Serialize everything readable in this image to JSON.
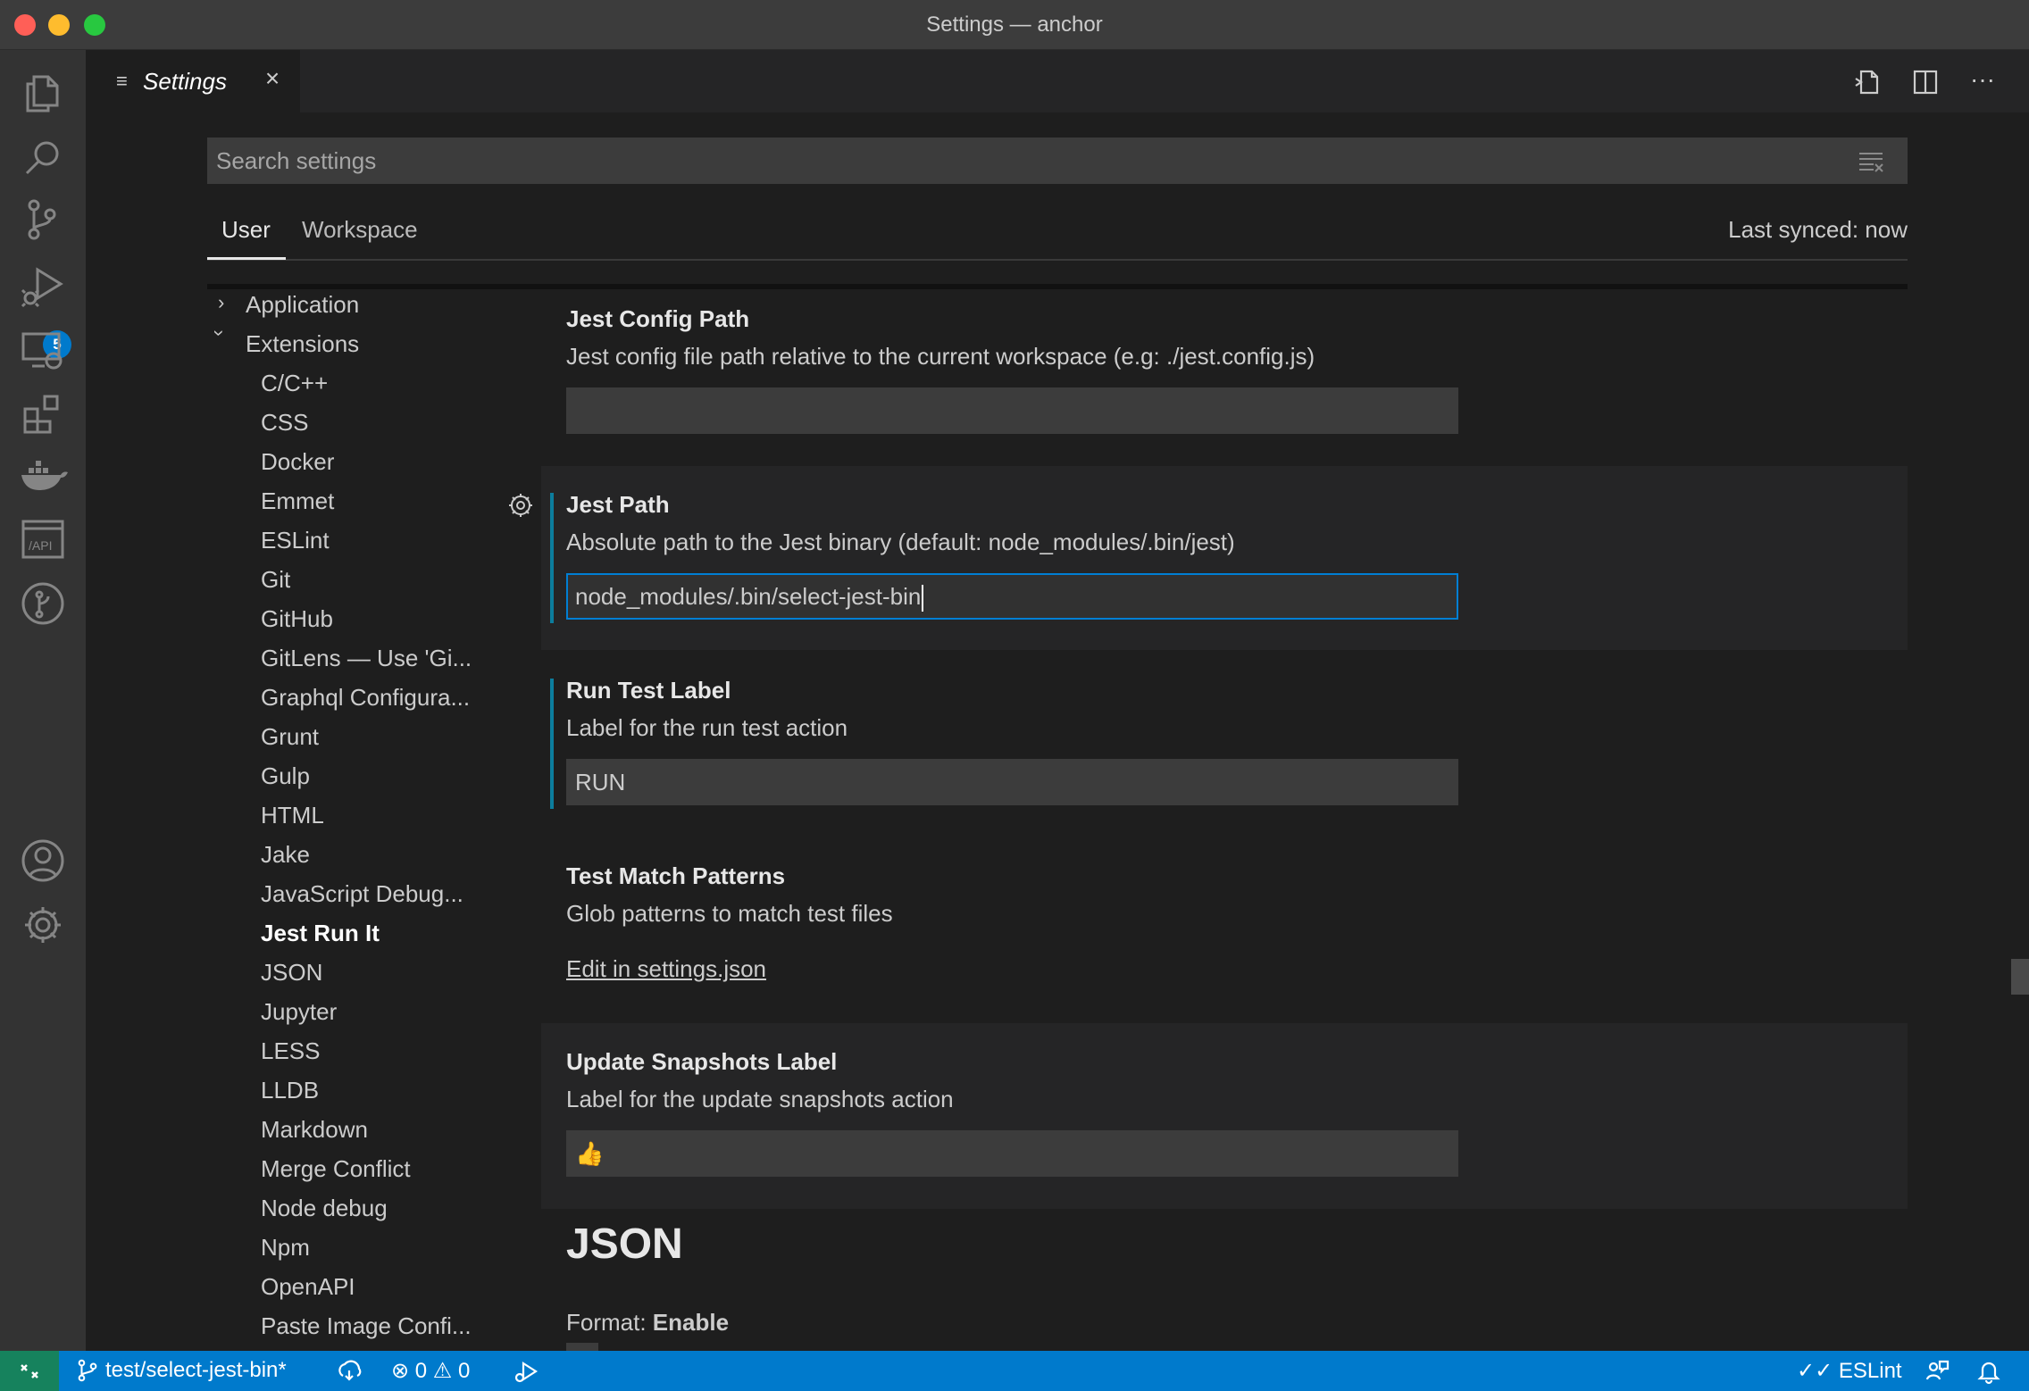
{
  "window": {
    "title": "Settings — anchor"
  },
  "activity_bar": {
    "items": [
      "explorer-icon",
      "search-icon",
      "source-control-icon",
      "run-debug-icon",
      "remote-explorer-icon",
      "extensions-icon",
      "docker-icon",
      "api-icon",
      "git-graph-icon",
      "account-icon",
      "manage-gear-icon"
    ],
    "scm_badge": "5"
  },
  "tabs": [
    {
      "label": "Settings",
      "icon": "settings-list-icon",
      "close": "×"
    }
  ],
  "toolbar": {
    "more": "···"
  },
  "search": {
    "placeholder": "Search settings"
  },
  "scope": {
    "user": "User",
    "workspace": "Workspace",
    "last_synced": "Last synced: now"
  },
  "toc": {
    "application": "Application",
    "extensions": "Extensions",
    "items": [
      "C/C++",
      "CSS",
      "Docker",
      "Emmet",
      "ESLint",
      "Git",
      "GitHub",
      "GitLens — Use 'Gi...",
      "Graphql Configura...",
      "Grunt",
      "Gulp",
      "HTML",
      "Jake",
      "JavaScript Debug...",
      "Jest Run It",
      "JSON",
      "Jupyter",
      "LESS",
      "LLDB",
      "Markdown",
      "Merge Conflict",
      "Node debug",
      "Npm",
      "OpenAPI",
      "Paste Image Confi..."
    ],
    "active": "Jest Run It"
  },
  "settings": {
    "jest_config_path": {
      "title": "Jest Config Path",
      "desc": "Jest config file path relative to the current workspace (e.g: ./jest.config.js)",
      "value": ""
    },
    "jest_path": {
      "title": "Jest Path",
      "desc": "Absolute path to the Jest binary (default: node_modules/.bin/jest)",
      "value": "node_modules/.bin/select-jest-bin"
    },
    "run_test_label": {
      "title": "Run Test Label",
      "desc": "Label for the run test action",
      "value": "RUN"
    },
    "test_match_patterns": {
      "title": "Test Match Patterns",
      "desc": "Glob patterns to match test files",
      "link": "Edit in settings.json"
    },
    "update_snapshots_label": {
      "title": "Update Snapshots Label",
      "desc": "Label for the update snapshots action",
      "value": "👍"
    },
    "json_section": "JSON",
    "format_enable": {
      "category": "Format: ",
      "name": "Enable"
    }
  },
  "statusbar": {
    "branch": "test/select-jest-bin*",
    "errors": "0",
    "warnings": "0",
    "eslint": "ESLint"
  },
  "colors": {
    "accent": "#007acc",
    "remote": "#16825d",
    "modified": "#0c7d9d"
  }
}
